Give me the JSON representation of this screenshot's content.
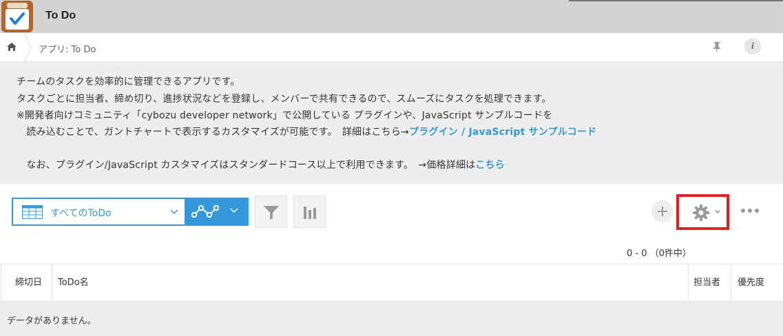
{
  "app": {
    "title": "To Do"
  },
  "breadcrumb": {
    "text": "アプリ: To Do"
  },
  "description": {
    "line1": "チームのタスクを効率的に管理できるアプリです。",
    "line2": "タスクごとに担当者、締め切り、進捗状況などを登録し、メンバーで共有できるので、スムーズにタスクを処理できます。",
    "line3": "※開発者向けコミュニティ「cybozu developer network」で公開している プラグインや、JavaScript サンプルコードを",
    "line4_prefix": "　読み込むことで、ガントチャートで表示するカスタマイズが可能です。　詳細はこちら→",
    "link_plugin": "プラグイン",
    "link_sep": " / ",
    "link_js": "JavaScript サンプルコード",
    "line5_prefix": "　なお、プラグイン/JavaScript カスタマイズはスタンダードコース以上で利用できます。　→価格詳細は",
    "link_price": "こちら"
  },
  "toolbar": {
    "view_label": "すべてのToDo",
    "icons": [
      "list-view-icon",
      "chevron-down-icon",
      "graph-icon",
      "filter-icon",
      "chart-icon",
      "plus-icon",
      "gear-icon",
      "more-icon"
    ]
  },
  "pager": {
    "text": "0 - 0 （0件中）"
  },
  "table": {
    "headers": [
      "締切日",
      "ToDo名",
      "担当者",
      "優先度"
    ],
    "empty_message": "データがありません。"
  },
  "colors": {
    "accent": "#3498db",
    "highlight": "#e01e25",
    "header_bg": "#d3d3d3"
  }
}
